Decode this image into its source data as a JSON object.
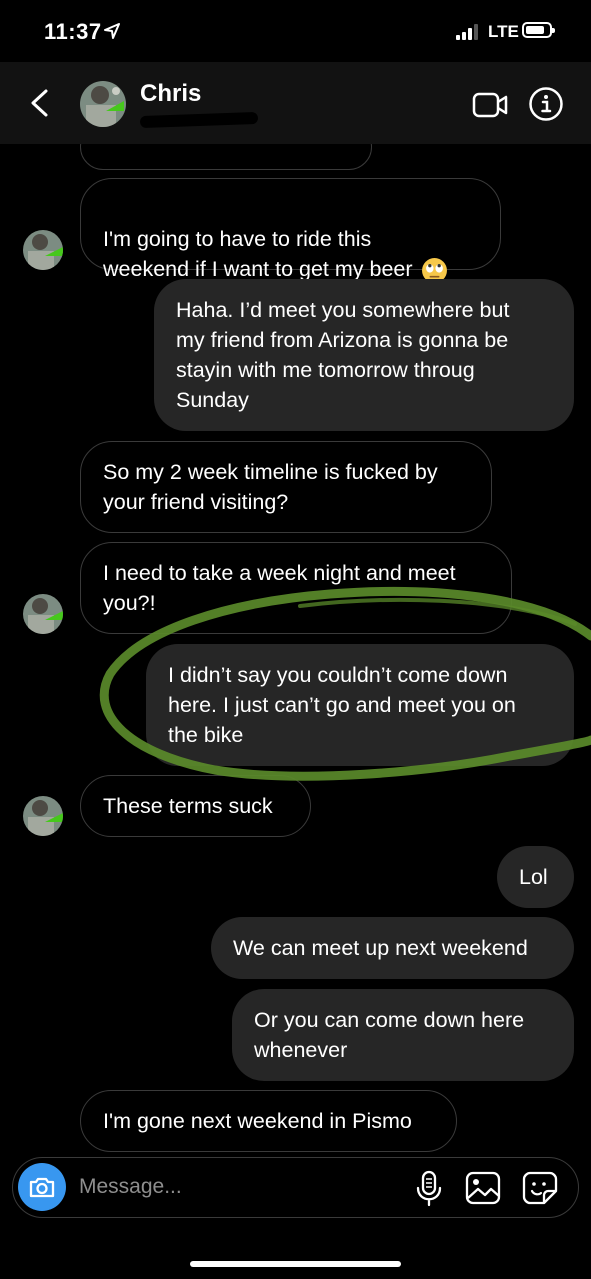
{
  "status_bar": {
    "time": "11:37",
    "network": "LTE"
  },
  "header": {
    "contact_name": "Chris"
  },
  "messages": [
    {
      "id": "m0",
      "direction": "incoming",
      "text": ""
    },
    {
      "id": "m1",
      "direction": "incoming",
      "text": "I'm going to have to ride this\nweekend if I want to get my beer",
      "emoji": "face-with-rolling-eyes"
    },
    {
      "id": "m2",
      "direction": "outgoing",
      "text": "Haha. I’d meet you somewhere but\nmy friend from Arizona  is gonna be\nstayin with me tomorrow throug\nSunday"
    },
    {
      "id": "m3",
      "direction": "incoming",
      "text": "So my 2 week timeline is fucked by\nyour friend visiting?"
    },
    {
      "id": "m4",
      "direction": "incoming",
      "text": "I need to take a week night and meet\nyou?!"
    },
    {
      "id": "m5",
      "direction": "outgoing",
      "text": "I didn’t say you couldn’t come down\nhere. I just can’t go and meet you on\nthe bike"
    },
    {
      "id": "m6",
      "direction": "incoming",
      "text": "These terms suck"
    },
    {
      "id": "m7",
      "direction": "outgoing",
      "text": "Lol"
    },
    {
      "id": "m8",
      "direction": "outgoing",
      "text": "We can meet up next weekend"
    },
    {
      "id": "m9",
      "direction": "outgoing",
      "text": "Or you can come down here\nwhenever"
    },
    {
      "id": "m10",
      "direction": "incoming",
      "text": "I'm gone next weekend in Pismo"
    }
  ],
  "composer": {
    "placeholder": "Message..."
  },
  "colors": {
    "background": "#000000",
    "outgoing_bubble": "#262626",
    "incoming_border": "#3a3a3a",
    "camera_button": "#3897f0",
    "annotation": "#5a8a2a"
  },
  "icons": [
    "location-arrow-icon",
    "back-chevron-icon",
    "video-call-icon",
    "info-icon",
    "camera-icon",
    "microphone-icon",
    "gallery-icon",
    "sticker-icon",
    "face-with-rolling-eyes"
  ]
}
